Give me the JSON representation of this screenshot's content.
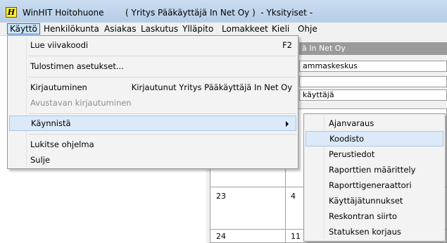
{
  "window": {
    "app_icon_letter": "H",
    "title": "WinHIT Hoitohuone        ( Yritys Pääkäyttäjä In Net Oy )  - Yksityiset -"
  },
  "menubar": {
    "items": [
      "Käyttö",
      "Henkilökunta",
      "Asiakas",
      "Laskutus",
      "Ylläpito",
      "Lomakkeet",
      "Kieli",
      "Ohje"
    ]
  },
  "background": {
    "header_text": "ä In Net Oy",
    "field1": "ammaskeskus",
    "field2": "",
    "field3": "käyttäjä",
    "grid_numbers": [
      "23",
      "4",
      "24",
      "11"
    ]
  },
  "dropdown": {
    "read_code": "Lue viivakoodi",
    "read_code_shortcut": "F2",
    "printer_settings": "Tulostimen asetukset...",
    "login": "Kirjautuminen",
    "login_status": "Kirjautunut Yritys Pääkäyttäjä In Net Oy",
    "assistant_login": "Avustavan kirjautuminen",
    "start": "Käynnistä",
    "lock": "Lukitse ohjelma",
    "close": "Sulje"
  },
  "submenu": {
    "items": [
      "Ajanvaraus",
      "Koodisto",
      "Perustiedot",
      "Raporttien määrittely",
      "Raporttigeneraattori",
      "Käyttäjätunnukset",
      "Reskontran siirto",
      "Statuksen korjaus"
    ],
    "highlighted": "Koodisto"
  },
  "colors": {
    "highlight": "#dbe9f8",
    "menu_active": "#cce4f7",
    "titlebar": "#c9dcf0"
  }
}
